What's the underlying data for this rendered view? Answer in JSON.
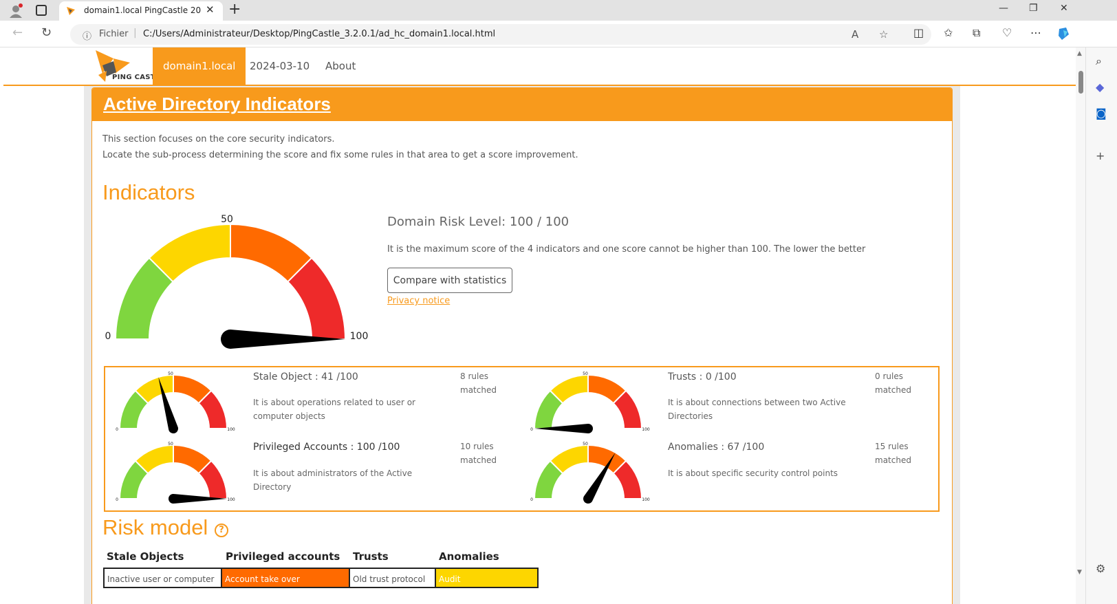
{
  "browser": {
    "tab_title": "domain1.local PingCastle 2024-0",
    "scheme_label": "Fichier",
    "url": "C:/Users/Administrateur/Desktop/PingCastle_3.2.0.1/ad_hc_domain1.local.html"
  },
  "nav": {
    "domain": "domain1.local",
    "date": "2024-03-10",
    "about": "About",
    "logo_text": "PING CASTLE"
  },
  "section": {
    "title": "Active Directory Indicators",
    "intro_line1": "This section focuses on the core security indicators.",
    "intro_line2": "Locate the sub-process determining the score and fix some rules in that area to get a score improvement."
  },
  "indicators": {
    "heading": "Indicators",
    "risk_level": "Domain Risk Level: 100 / 100",
    "risk_desc": "It is the maximum score of the 4 indicators and one score cannot be higher than 100. The lower the better",
    "compare_button": "Compare with statistics",
    "privacy_notice": "Privacy notice",
    "main_score": 100,
    "gauge_labels": {
      "min": "0",
      "mid": "50",
      "max": "100"
    },
    "items": [
      {
        "title": "Stale Object : 41 /100",
        "score": 41,
        "desc": "It is about operations related to user or computer objects",
        "rules": "8 rules matched"
      },
      {
        "title": "Trusts : 0 /100",
        "score": 0,
        "desc": "It is about connections between two Active Directories",
        "rules": "0 rules matched"
      },
      {
        "title": "Privileged Accounts : 100 /100",
        "score": 100,
        "desc": "It is about administrators of the Active Directory",
        "rules": "10 rules matched"
      },
      {
        "title": "Anomalies : 67 /100",
        "score": 67,
        "desc": "It is about specific security control points",
        "rules": "15 rules matched"
      }
    ]
  },
  "risk_model": {
    "heading": "Risk model",
    "columns": [
      "Stale Objects",
      "Privileged accounts",
      "Trusts",
      "Anomalies"
    ],
    "first_row": [
      "Inactive user or computer",
      "Account take over",
      "Old trust protocol",
      "Audit"
    ]
  },
  "colors": {
    "accent": "#f89a1c",
    "gauge": [
      "#7fd63f",
      "#fdd600",
      "#ff6a00",
      "#ee2a2a"
    ]
  }
}
